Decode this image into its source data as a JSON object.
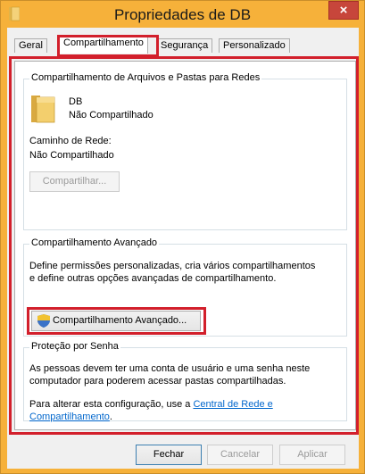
{
  "window": {
    "title": "Propriedades de DB",
    "close_label": "×"
  },
  "tabs": [
    {
      "label": "Geral"
    },
    {
      "label": "Compartilhamento"
    },
    {
      "label": "Segurança"
    },
    {
      "label": "Personalizado"
    }
  ],
  "network_sharing": {
    "title": "Compartilhamento de Arquivos e Pastas para Redes",
    "folder_name": "DB",
    "status": "Não Compartilhado",
    "network_path_label": "Caminho de Rede:",
    "network_path_value": "Não Compartilhado",
    "share_button": "Compartilhar..."
  },
  "advanced_sharing": {
    "title": "Compartilhamento Avançado",
    "description_line1": "Define permissões personalizadas, cria vários compartilhamentos",
    "description_line2": "e define outras opções avançadas de compartilhamento.",
    "button": "Compartilhamento Avançado..."
  },
  "password_protection": {
    "title": "Proteção por Senha",
    "line1": "As pessoas devem ter uma conta de usuário e uma senha neste",
    "line2": "computador para poderem acessar pastas compartilhadas.",
    "line3": "Para alterar esta configuração, use a",
    "link_part1": "Central de Rede e",
    "link_part2": "Compartilhamento",
    "line_end": "."
  },
  "footer": {
    "close": "Fechar",
    "cancel": "Cancelar",
    "apply": "Aplicar"
  },
  "colors": {
    "highlight": "#d21f2b",
    "link": "#0066cc",
    "title_bar": "#f6b13a"
  }
}
